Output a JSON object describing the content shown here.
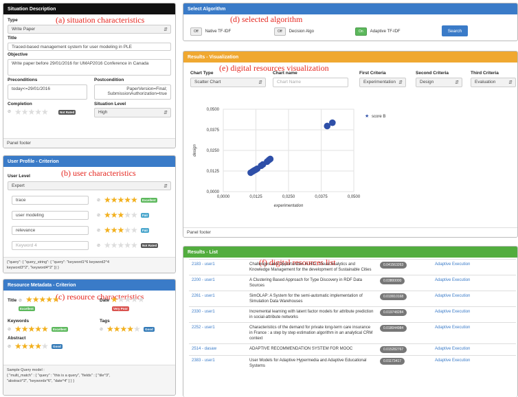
{
  "situation": {
    "header": "Situation Description",
    "annotation": "(a) situation characteristics",
    "type_label": "Type",
    "type_value": "Write Paper",
    "title_label": "Title",
    "title_value": "Traced-based management system for user modeling in PLE",
    "objective_label": "Objective",
    "objective_value": "Write paper before 29/01/2016 for UMAP2016 Conference in Canada",
    "pre_label": "Preconditions",
    "pre_value": "today<=29/01/2016",
    "post_label": "Postcondition",
    "post_value_1": "PaperVersion=Final;",
    "post_value_2": "SubmissionAuthorization=true",
    "completion_label": "Completion",
    "completion_badge": "Not Rated",
    "level_label": "Situation Level",
    "level_value": "High",
    "footer": "Panel footer"
  },
  "user": {
    "header": "User Profile - Criterion",
    "annotation": "(b) user characteristics",
    "level_label": "User Level",
    "level_value": "Expert",
    "keywords": [
      {
        "value": "trace",
        "badge": "Excellent",
        "rating": 5
      },
      {
        "value": "user modeling",
        "badge": "Fair",
        "rating": 3
      },
      {
        "value": "relevance",
        "badge": "Fair",
        "rating": 3
      }
    ],
    "keyword_placeholder": "Keyword 4",
    "keyword4_badge": "Not Rated",
    "query_1": "{\"query\": { \"query_string\": { \"query\": \"keyword1^6 keyword2^4",
    "query_2": "keyword3^2\", \"keyword4^2\" }} }"
  },
  "resource": {
    "header": "Resource Metadata - Criterion",
    "annotation": "(c) resource characteristics",
    "title_label": "Title",
    "title_badge": "Excellent",
    "date_label": "Date",
    "date_badge": "Very Poor",
    "keywords_label": "Keywords",
    "keywords_badge": "Excellent",
    "tags_label": "Tags",
    "tags_badge": "Good",
    "abstract_label": "Abstract",
    "abstract_badge": "Good",
    "query_title": "Sample Query model :",
    "query_1": "{ \"multi_match\" : { \"query\" : \"this is a query\", \"fields\" : [ \"tile^3\",",
    "query_2": "\"abstract^2\", \"keywords^6\", \"date^4\" ] } }"
  },
  "algo": {
    "header": "Select Algorithm",
    "annotation": "(d) selected algorithm",
    "opt1_toggle": "Off",
    "opt1": "Native TF-IDF",
    "opt2_toggle": "Off",
    "opt2": "Decision Algo",
    "opt3_toggle": "On",
    "opt3": "Adaptive TF-IDF",
    "search": "Search"
  },
  "viz": {
    "header": "Results - Visualization",
    "annotation": "(e) digital resources visualization",
    "chart_type_label": "Chart Type",
    "chart_type": "Scatter Chart",
    "chart_name_label": "Chart name",
    "chart_name_placeholder": "Chart Name",
    "first_label": "First Criteria",
    "first": "Experimentation",
    "second_label": "Second Criteria",
    "second": "Design",
    "third_label": "Third Criteria",
    "third": "Evaluation",
    "footer": "Panel footer"
  },
  "chart_data": {
    "type": "scatter",
    "series": [
      {
        "name": "score B",
        "color": "#2e4fa8",
        "points": [
          [
            0.0105,
            0.0115
          ],
          [
            0.0112,
            0.0122
          ],
          [
            0.0118,
            0.0128
          ],
          [
            0.0124,
            0.0133
          ],
          [
            0.013,
            0.0139
          ],
          [
            0.0145,
            0.0157
          ],
          [
            0.0152,
            0.0165
          ],
          [
            0.0168,
            0.0182
          ],
          [
            0.0175,
            0.0192
          ],
          [
            0.018,
            0.0198
          ],
          [
            0.0398,
            0.0398
          ],
          [
            0.0418,
            0.0418
          ]
        ]
      }
    ],
    "xlabel": "experimentation",
    "ylabel": "design",
    "xlim": [
      0,
      0.05
    ],
    "ylim": [
      0,
      0.05
    ],
    "xticks": [
      "0,0000",
      "0,0125",
      "0,0250",
      "0,0375",
      "0,0500"
    ],
    "yticks": [
      "0,0000",
      "0,0125",
      "0,0250",
      "0,0375",
      "0,0500"
    ]
  },
  "results": {
    "header": "Results - List",
    "annotation": "(f) digital resources list",
    "rows": [
      {
        "id": "2183 - user1",
        "title": "Challenges and Opportunities in HCI, Visual Analytics and Knowledge Management for the development of Sustainable Cities",
        "score": "0.041563263",
        "action": "Adaptive Execution"
      },
      {
        "id": "2200 - user1",
        "title": "A Clustering Based Approach for Type Discovery in RDF Data Sources",
        "score": "0.03800000",
        "action": "Adaptive Execution"
      },
      {
        "id": "2261 - user1",
        "title": "SimOLAP: A System for the semi-automatic implementation of Simulation Data Warehouses",
        "score": "0.019910168",
        "action": "Adaptive Execution"
      },
      {
        "id": "2330 - user1",
        "title": "Incremental learning with latent factor models for attribute prediction in social-attribute networks",
        "score": "0.019748284",
        "action": "Adaptive Execution"
      },
      {
        "id": "2252 - user1",
        "title": "Characteristics of the demand for private long-term care insurance in France : a step by step estimation algorithm in an analytical CRM context",
        "score": "0.018044984",
        "action": "Adaptive Execution"
      },
      {
        "id": "2514 - dasaw",
        "title": "ADAPTIVE RECOMMENDATION SYSTEM FOR MOOC",
        "score": "0.015282767",
        "action": "Adaptive Execution"
      },
      {
        "id": "2383 - user1",
        "title": "User Models for Adaptive Hypermedia and Adaptive Educational Systems",
        "score": "0.01173417",
        "action": "Adaptive Execution"
      }
    ]
  }
}
